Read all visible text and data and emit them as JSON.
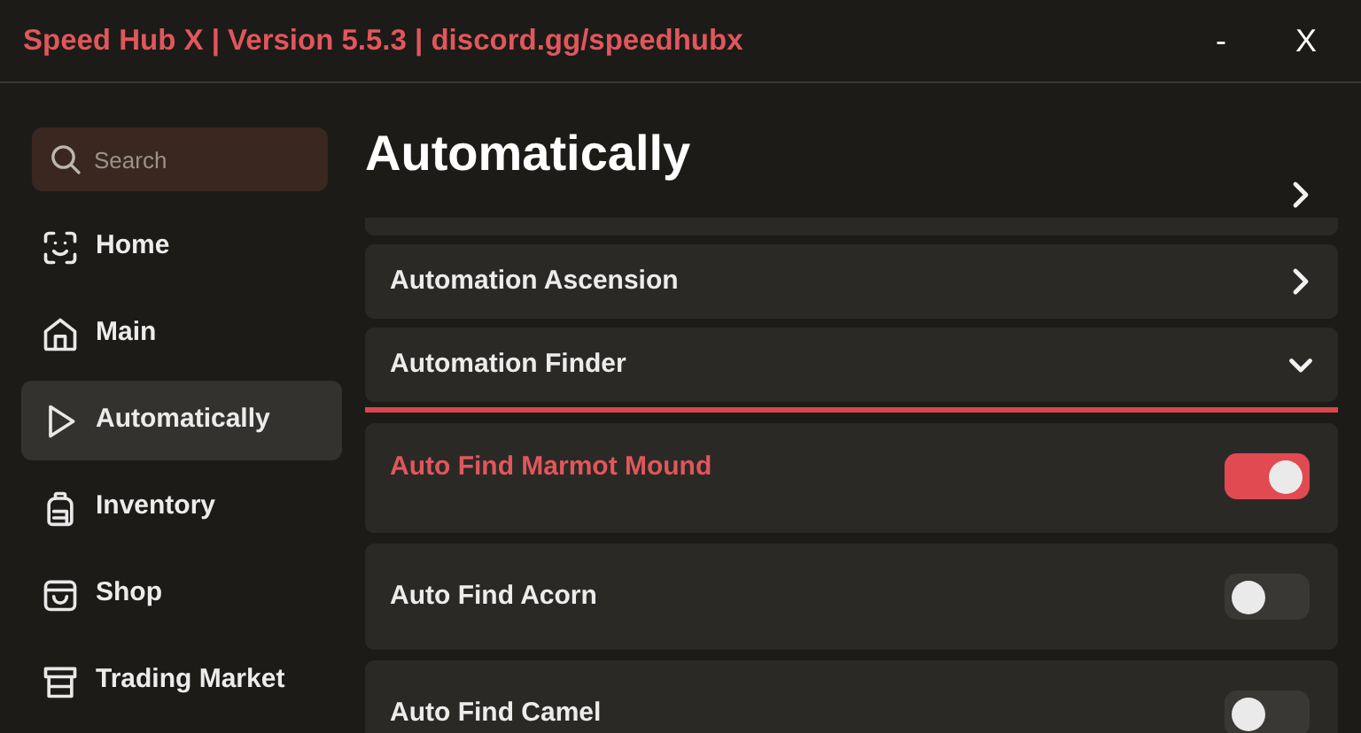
{
  "window": {
    "title": "Speed Hub X | Version 5.5.3 | discord.gg/speedhubx",
    "minimize": "-",
    "close": "X"
  },
  "search": {
    "placeholder": "Search"
  },
  "sidebar": {
    "items": [
      {
        "label": "Home",
        "selected": false
      },
      {
        "label": "Main",
        "selected": false
      },
      {
        "label": "Automatically",
        "selected": true
      },
      {
        "label": "Inventory",
        "selected": false
      },
      {
        "label": "Shop",
        "selected": false
      },
      {
        "label": "Trading Market",
        "selected": false
      }
    ]
  },
  "page": {
    "title": "Automatically"
  },
  "sections": [
    {
      "kind": "partial",
      "expanded": false
    },
    {
      "kind": "section",
      "label": "Automation Ascension",
      "expanded": false
    },
    {
      "kind": "section",
      "label": "Automation Finder",
      "expanded": true
    }
  ],
  "toggles": [
    {
      "label": "Auto Find Marmot Mound",
      "on": true
    },
    {
      "label": "Auto Find Acorn",
      "on": false
    },
    {
      "label": "Auto Find Camel",
      "on": false
    }
  ]
}
